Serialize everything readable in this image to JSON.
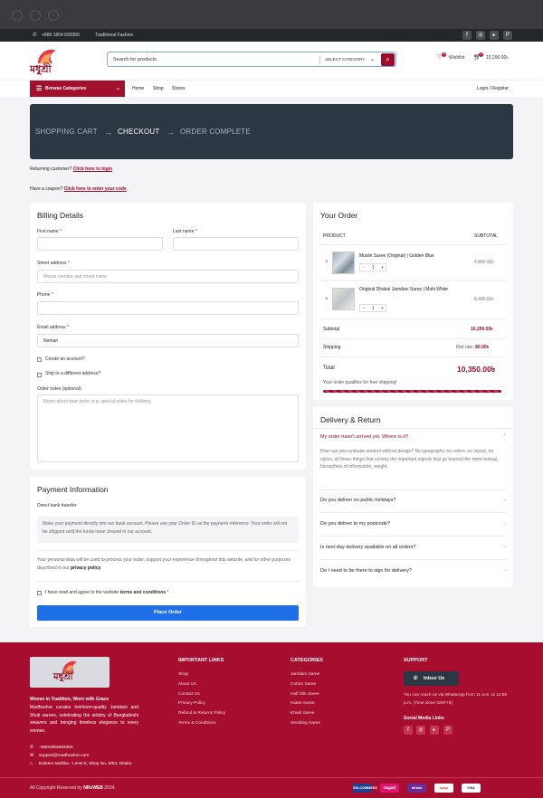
{
  "topbar": {
    "phone": "+880 1804 693360",
    "tagline": "Traditional Fashion"
  },
  "header": {
    "logo_text": "মধুশ্রী",
    "search_placeholder": "Search for products",
    "category_label": "SELECT CATEGORY",
    "wishlist_label": "Wishlist",
    "wishlist_count": "0",
    "cart_count": "2",
    "cart_total": "10,290.00৳"
  },
  "nav": {
    "browse_label": "Browse Categories",
    "links": [
      "Home",
      "Shop",
      "Stores"
    ],
    "account": "Login / Register"
  },
  "steps": [
    "SHOPPING CART",
    "CHECKOUT",
    "ORDER COMPLETE"
  ],
  "notices": {
    "returning": "Returning customer?",
    "login_link": "Click here to login",
    "coupon": "Have a coupon?",
    "coupon_link": "Click here to enter your code"
  },
  "billing": {
    "title": "Billing Details",
    "first_name": "First name",
    "last_name": "Last name",
    "street": "Street address",
    "street_placeholder": "House number and street name",
    "phone": "Phone",
    "email": "Email address",
    "email_value": "Noman",
    "create_account": "Create an account?",
    "ship_different": "Ship to a different address?",
    "order_notes": "Order notes (optional)",
    "notes_placeholder": "Notes about your order, e.g. special notes for delivery."
  },
  "payment": {
    "title": "Payment Information",
    "method": "Direct bank transfer",
    "instructions": "Make your payment directly into our bank account. Please use your Order ID as the payment reference. Your order will not be shipped until the funds have cleared in our account.",
    "privacy_text": "Your personal data will be used to process your order, support your experience throughout this website, and for other purposes described in our",
    "privacy_link": "privacy policy",
    "terms_text": "I have read and agree to the website",
    "terms_link": "terms and conditions",
    "place_order": "Place Order"
  },
  "order": {
    "title": "Your Order",
    "col_product": "PRODUCT",
    "col_subtotal": "SUBTOTAL",
    "items": [
      {
        "name": "Muslin Saree (Original) | Golden Blue",
        "qty": "1",
        "price": "4,800.00৳"
      },
      {
        "name": "Original Dhakai Jamdani Saree | Multi White",
        "qty": "1",
        "price": "5,490.00৳"
      }
    ],
    "subtotal_label": "Subtotal",
    "subtotal": "10,290.00৳",
    "shipping_label": "Shipping",
    "shipping_value": "Flat rate:",
    "shipping_amount": "80.00৳",
    "total_label": "Total",
    "total": "10,350.00৳",
    "free_shipping": "Your order qualifies for free shipping!",
    "free_shipping_progress": 1.0
  },
  "delivery": {
    "title": "Delivery & Return",
    "open_question": "My order hasn't arrived yet. Where is it?",
    "open_answer": "How can you evaluate content without design? No typography, no colors, no layout, no styles, all those things that convey the important signals that go beyond the mere textual, hierarchies of information, weight.",
    "questions": [
      "Do you deliver on public holidays?",
      "Do you deliver to my postcode?",
      "Is next-day delivery available on all orders?",
      "Do I need to be there to sign for delivery?"
    ]
  },
  "footer": {
    "logo_text": "মধুশ্রী",
    "slogan": "Woven in Tradition, Worn with Grace",
    "about": "Madhushre curates heirloom-quality Jamdani and Shuti sarees, celebrating the artistry of Bangladeshi weavers and bringing timeless elegance to every woman.",
    "phone": "+8801804693360",
    "email": "support@madhushre.com",
    "address": "Eastern Mollika - Level 5, Shop No. 5/53, Dhaka",
    "links_title": "IMPORTANT LINKS",
    "links": [
      "Shop",
      "About Us",
      "Contact Us",
      "Privacy Policy",
      "Refund & Returns Policy",
      "Terms & Conditions"
    ],
    "categories_title": "CATEGORIES",
    "categories": [
      "Jamdani Saree",
      "Cotton Saree",
      "Half Silk Saree",
      "Katan Saree",
      "Khadi Saree",
      "Wedding Saree"
    ],
    "support_title": "SUPPORT",
    "inbox_button": "Inbox Us",
    "support_text": "You can reach us via WhatsApp from 11 a.m. to 11:59 p.m. (Time Zone GMT+6)",
    "social_title": "Social Media Links",
    "copyright": "All Copyright Reserved by",
    "copyright_brand": "NRxWEB",
    "copyright_year": "2024.",
    "payments": [
      "SSLCOMMERZ",
      "nagad",
      "bKash",
      "upay",
      "VISA"
    ],
    "payment_colors": [
      "#1f3f8f",
      "#e2136e",
      "#6a2c91",
      "#f7b500",
      "#ffffff"
    ]
  }
}
